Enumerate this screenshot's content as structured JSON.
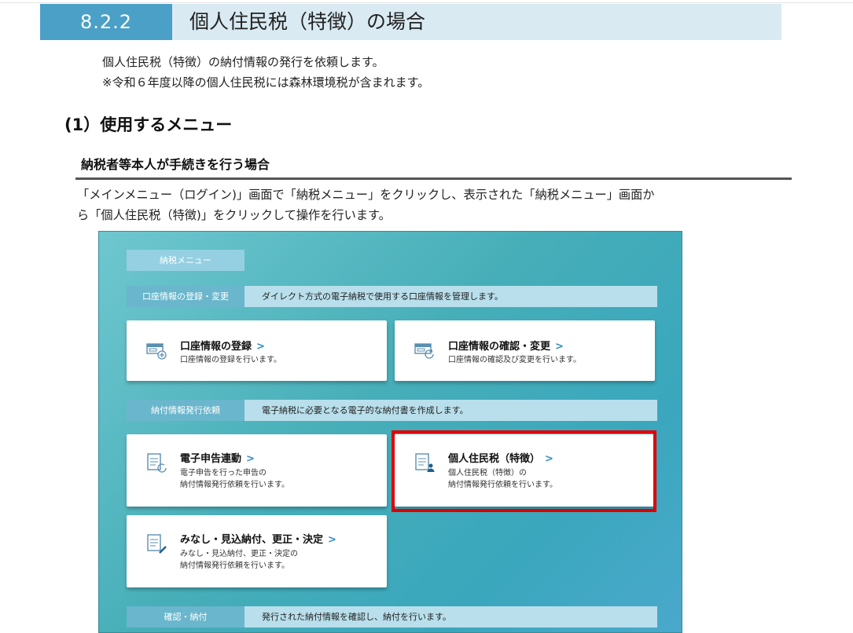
{
  "section": {
    "number": "8.2.2",
    "title": "個人住民税（特徴）の場合"
  },
  "intro": {
    "line1": "個人住民税（特徴）の納付情報の発行を依頼します。",
    "line2": "※令和６年度以降の個人住民税には森林環境税が含まれます。"
  },
  "heading2": "(1）使用するメニュー",
  "heading3": "納税者等本人が手続きを行う場合",
  "description": {
    "line1": "「メインメニュー（ログイン)」画面で「納税メニュー」をクリックし、表示された「納税メニュー」画面か",
    "line2": "ら「個人住民税（特徴)」をクリックして操作を行います。"
  },
  "screenshot": {
    "menu_tag": "納税メニュー",
    "categories": [
      {
        "label": "口座情報の登録・変更",
        "description": "ダイレクト方式の電子納税で使用する口座情報を管理します。"
      },
      {
        "label": "納付情報発行依頼",
        "description": "電子納税に必要となる電子的な納付書を作成します。"
      },
      {
        "label": "確認・納付",
        "description": "発行された納付情報を確認し、納付を行います。"
      }
    ],
    "cards": [
      {
        "title": "口座情報の登録",
        "chevron": ">",
        "desc1": "口座情報の登録を行います。",
        "desc2": "",
        "icon": "bank-add-icon"
      },
      {
        "title": "口座情報の確認・変更",
        "chevron": ">",
        "desc1": "口座情報の確認及び変更を行います。",
        "desc2": "",
        "icon": "bank-refresh-icon"
      },
      {
        "title": "電子申告連動",
        "chevron": ">",
        "desc1": "電子申告を行った申告の",
        "desc2": "納付情報発行依頼を行います。",
        "icon": "document-refresh-icon"
      },
      {
        "title": "個人住民税（特徴）",
        "chevron": ">",
        "desc1": "個人住民税（特徴）の",
        "desc2": "納付情報発行依頼を行います。",
        "icon": "document-person-icon"
      },
      {
        "title": "みなし・見込納付、更正・決定",
        "chevron": ">",
        "desc1": "みなし・見込納付、更正・決定の",
        "desc2": "納付情報発行依頼を行います。",
        "icon": "document-edit-icon"
      }
    ],
    "highlight_color": "#e00000"
  }
}
